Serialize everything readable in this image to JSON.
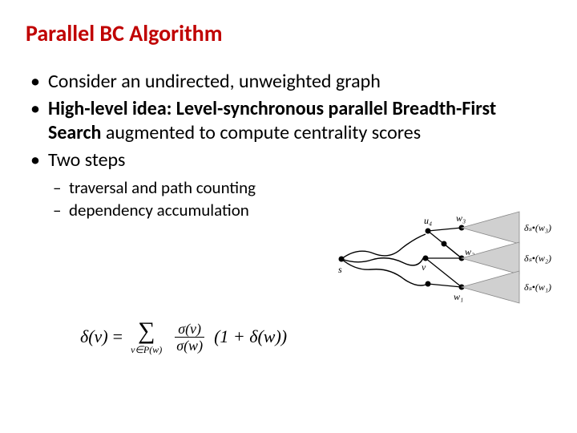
{
  "title": "Parallel BC Algorithm",
  "bullets": [
    {
      "text": "Consider an undirected, unweighted graph"
    },
    {
      "bold1": "High-level idea:",
      "mid1": " ",
      "bold2": "Level-synchronous parallel Breadth-First Search",
      "tail": " augmented to compute centrality scores"
    },
    {
      "text": "Two steps",
      "sub": [
        "traversal and path counting",
        "dependency accumulation"
      ]
    }
  ],
  "diagram": {
    "s": "s",
    "v": "v",
    "u4": "u₄",
    "w1": "w₁",
    "w2": "w₂",
    "w3": "w₃",
    "d_w1": "δₛ•(w₁)",
    "d_w2": "δₛ•(w₂)",
    "d_w3": "δₛ•(w₃)"
  },
  "formula": {
    "lhs": "δ(v)",
    "sum_sub": "v∈P(w)",
    "frac_num": "σ(v)",
    "frac_den": "σ(w)",
    "rhs": "(1 + δ(w))"
  }
}
